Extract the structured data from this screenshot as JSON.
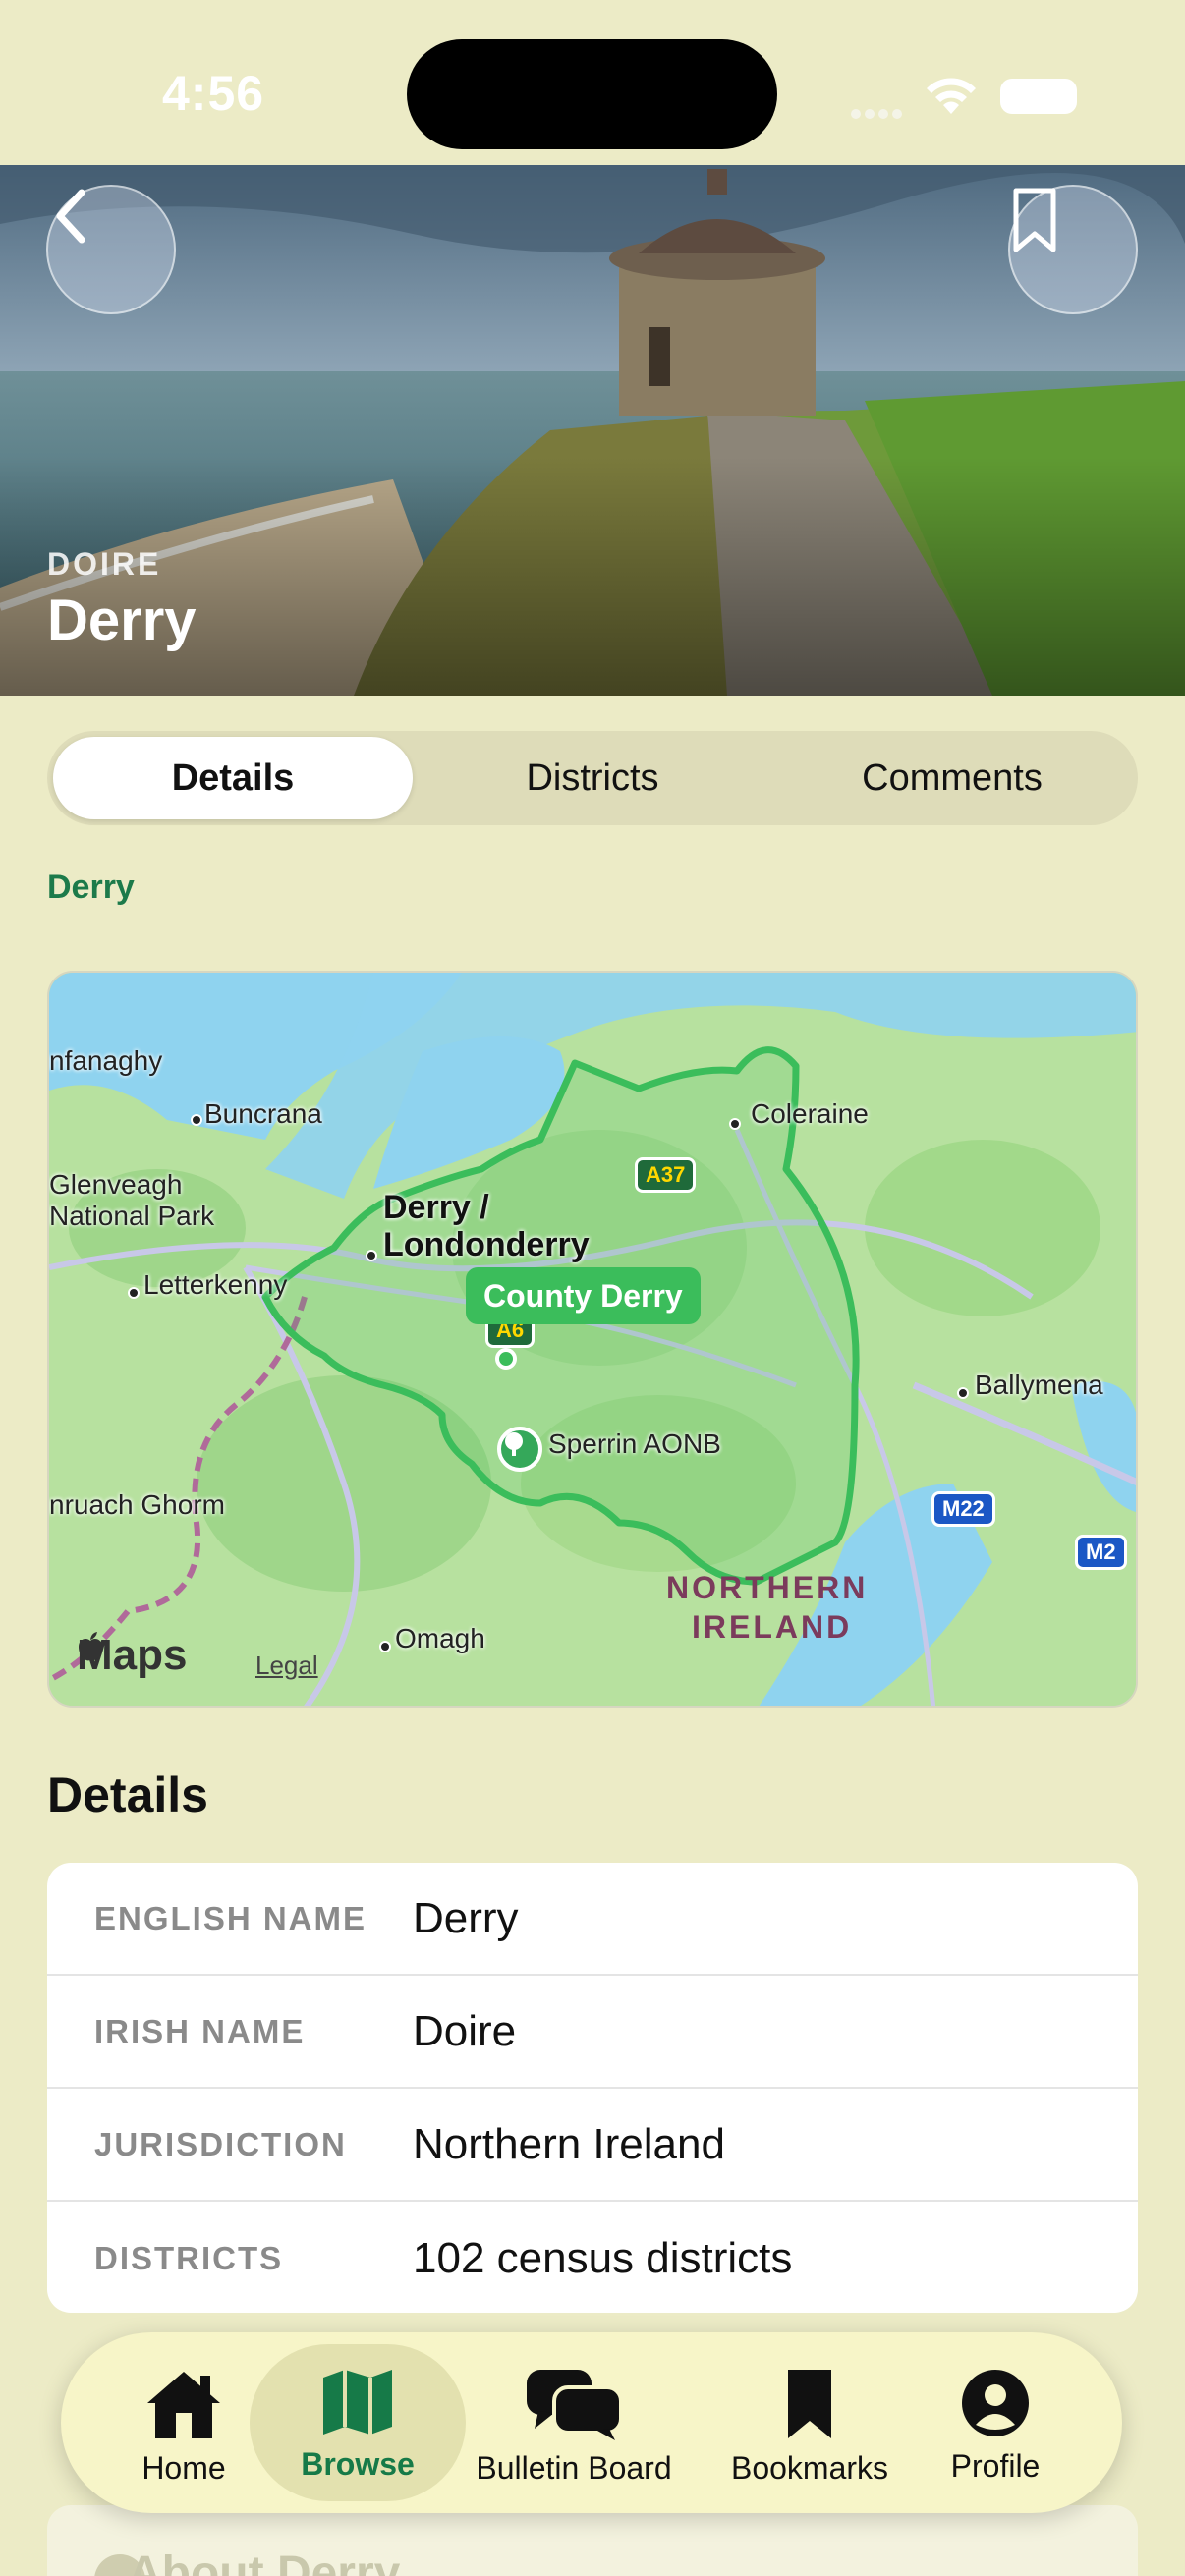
{
  "status_bar": {
    "time": "4:56"
  },
  "hero": {
    "subtitle": "DOIRE",
    "title": "Derry"
  },
  "segments": [
    {
      "label": "Details",
      "active": true
    },
    {
      "label": "Districts",
      "active": false
    },
    {
      "label": "Comments",
      "active": false
    }
  ],
  "county_link": "Derry",
  "map": {
    "places": {
      "nfanaghy": "nfanaghy",
      "buncrana": "Buncrana",
      "coleraine": "Coleraine",
      "glenveagh_1": "Glenveagh",
      "glenveagh_2": "National Park",
      "derry_1": "Derry /",
      "derry_2": "Londonderry",
      "letterkenny": "Letterkenny",
      "ballymena": "Ballymena",
      "sperrin": "Sperrin AONB",
      "cruach": "nruach Ghorm",
      "omagh": "Omagh",
      "ni_1": "NORTHERN",
      "ni_2": "IRELAND"
    },
    "roads": {
      "a37": "A37",
      "a6": "A6",
      "m22": "M22",
      "m2": "M2"
    },
    "county_pill": "County Derry",
    "attribution": "Maps",
    "legal": "Legal"
  },
  "details": {
    "heading": "Details",
    "rows": [
      {
        "key": "ENGLISH NAME",
        "value": "Derry"
      },
      {
        "key": "IRISH NAME",
        "value": "Doire"
      },
      {
        "key": "JURISDICTION",
        "value": "Northern Ireland"
      },
      {
        "key": "DISTRICTS",
        "value": "102 census districts"
      }
    ]
  },
  "about": {
    "label": "About Derry"
  },
  "tabbar": {
    "items": [
      {
        "label": "Home",
        "icon": "house-icon"
      },
      {
        "label": "Browse",
        "icon": "map-icon",
        "active": true
      },
      {
        "label": "Bulletin Board",
        "icon": "chat-bubbles-icon"
      },
      {
        "label": "Bookmarks",
        "icon": "bookmark-icon"
      },
      {
        "label": "Profile",
        "icon": "person-icon"
      }
    ]
  },
  "colors": {
    "background": "#ecebc6",
    "accent": "#1c7a4a",
    "county_green": "#3bbd5b"
  }
}
